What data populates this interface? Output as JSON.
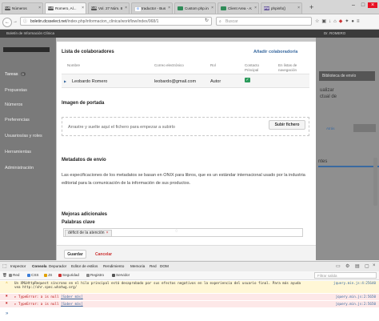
{
  "browser": {
    "tabs": [
      {
        "label": "Números",
        "icon": "OJS",
        "icon_color": "#555555"
      },
      {
        "label": "Romero, Al...",
        "icon": "OJS",
        "icon_color": "#555555",
        "active": true
      },
      {
        "label": "Vol. 27 Núm. 8 (...",
        "icon": "OJS",
        "icon_color": "#555555"
      },
      {
        "label": "traductor - Bus...",
        "icon": "G",
        "icon_color": "#4285f4"
      },
      {
        "label": "Custom php.ini...",
        "icon": "",
        "icon_color": "#2e8b57"
      },
      {
        "label": "Client Area - A2...",
        "icon": "",
        "icon_color": "#2e8b57"
      },
      {
        "label": "phpinfo()",
        "icon": "php",
        "icon_color": "#6a5a9c"
      }
    ],
    "url_domain": "boletin.dcsselect.net",
    "url_path": "/index.php/informacion_clinica/workflow/index/968/1",
    "search_placeholder": "Buscar"
  },
  "app": {
    "header_left": "Boletín de Información Clínica",
    "header_right": "Dr. ROMERO",
    "sidebar": [
      {
        "label": "Tareas",
        "badge": "0",
        "active": true
      },
      {
        "label": "Propuestas"
      },
      {
        "label": "Números"
      },
      {
        "label": "Preferencias"
      },
      {
        "label": "Usuarios/as y roles"
      },
      {
        "label": "Herramientas"
      },
      {
        "label": "Administración"
      }
    ],
    "right_panel": {
      "title": "Biblioteca de envío",
      "text_1": "ualizar",
      "text_2": "ctual de",
      "back_link": "Atrás",
      "partial_word": "ntes"
    }
  },
  "modal": {
    "collaborators": {
      "title": "Lista de colaboradores",
      "add_link": "Añadir colaborador/a",
      "headers": {
        "name": "Nombre",
        "email": "Correo electrónico",
        "role": "Rol",
        "contact": "Contacto Principal",
        "browse": "En listas de navegación"
      },
      "rows": [
        {
          "name": "Leobardo Romero",
          "email": "leobardo@gmail.com",
          "role": "Autor",
          "contact": true
        }
      ]
    },
    "cover": {
      "title": "Imagen de portada",
      "dropzone_text": "Arrastre y suelte aquí el fichero para empezar a subirlo",
      "upload_button": "Subir fichero"
    },
    "metadata": {
      "title": "Metadatos de envío",
      "description": "Las especificaciones de los metadatos se basan en ONIX para libros, que es un estándar internacional usado por la industria editorial para la comunicación de la información de sus productos."
    },
    "refinements": {
      "title": "Mejoras adicionales",
      "keywords_label": "Palabras clave",
      "keyword_tag": "déficit de la atención",
      "remove_glyph": "×"
    },
    "footer": {
      "save": "Guardar",
      "cancel": "Cancelar"
    }
  },
  "devtools": {
    "tabs": [
      "Inspector",
      "Consola",
      "Depurador",
      "Editor de estilos",
      "Rendimiento",
      "Memoria",
      "Red",
      "DOM"
    ],
    "selected_tab": "Consola",
    "filters": [
      {
        "label": "Red",
        "color": "#8a8a8a"
      },
      {
        "label": "CSS",
        "color": "#3b7dd8"
      },
      {
        "label": "JS",
        "color": "#e0a000"
      },
      {
        "label": "Seguridad",
        "color": "#cc3333"
      },
      {
        "label": "Registro",
        "color": "#888888"
      },
      {
        "label": "Servidor",
        "color": "#555555"
      }
    ],
    "filter_placeholder": "Filtrar salida",
    "messages": [
      {
        "type": "warn",
        "text": "Un XMLHttpRequest síncrono en el hilo principal está desaprobado por sus efectos negativos en la experiencia del usuario final. Para más ayuda vea http://xhr.spec.whatwg.org/",
        "source": "jquery.min.js:4:25640"
      },
      {
        "type": "err",
        "text": "TypeError: a is null",
        "link": "[Saber más]",
        "source": "jquery.min.js:2:5650"
      },
      {
        "type": "err",
        "text": "TypeError: a is null",
        "link": "[Saber más]",
        "source": "jquery.min.js:2:5650"
      }
    ],
    "prompt": "»"
  }
}
